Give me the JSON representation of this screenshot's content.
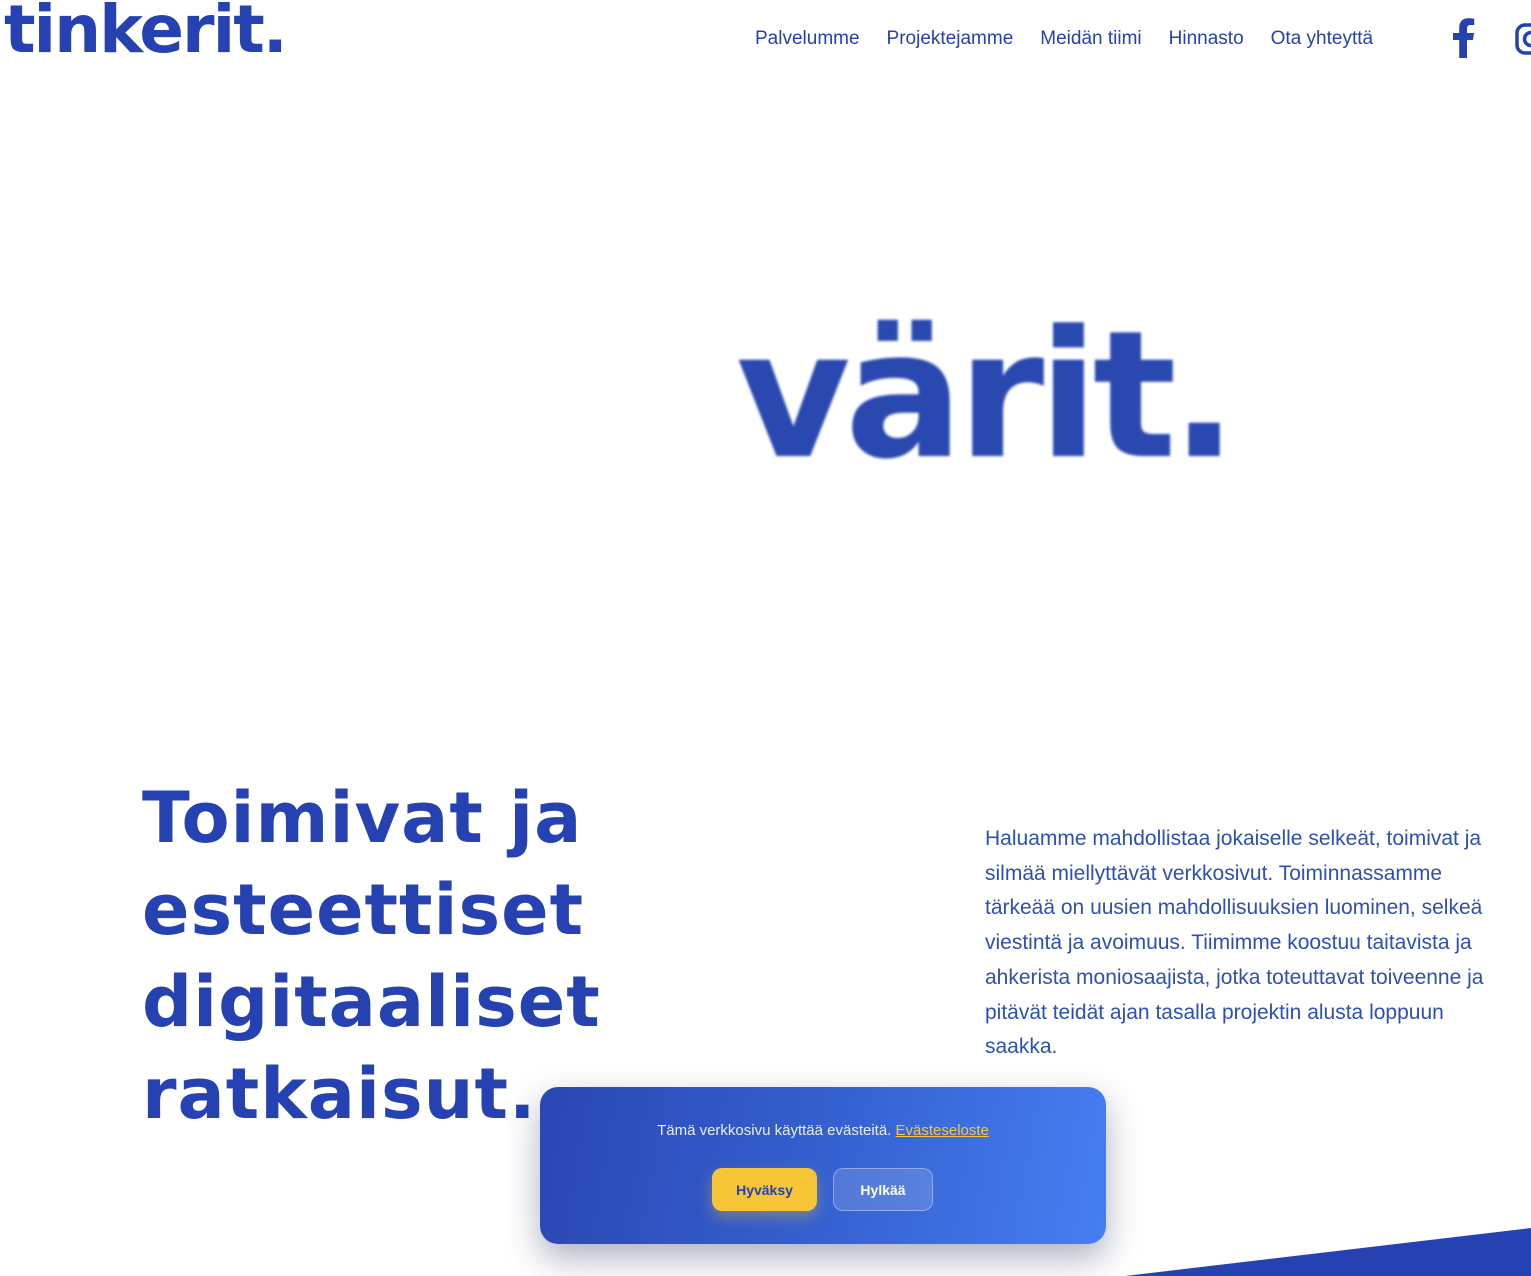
{
  "header": {
    "logo_text": "tinkerit.",
    "nav": [
      {
        "label": "Palvelumme"
      },
      {
        "label": "Projektejamme"
      },
      {
        "label": "Meidän tiimi"
      },
      {
        "label": "Hinnasto"
      },
      {
        "label": "Ota yhteyttä"
      }
    ],
    "social_icons": [
      "facebook-icon",
      "instagram-icon"
    ]
  },
  "hero": {
    "word": "värit."
  },
  "intro": {
    "headline": "Toimivat ja esteettiset digitaaliset ratkaisut.",
    "paragraph": "Haluamme mahdollistaa jokaiselle selkeät, toimivat ja silmää miellyttävät verkkosivut. Toiminnassamme tärkeää on uusien mahdollisuuksien luominen, selkeä viestintä ja avoimuus. Tiimimme koostuu taitavista ja ahkerista moniosaajista, jotka toteuttavat toiveenne ja pitävät teidät ajan tasalla projektin alusta loppuun saakka."
  },
  "cookie_banner": {
    "message": "Tämä verkkosivu käyttää evästeitä.",
    "link_label": "Evästeseloste",
    "accept_label": "Hyväksy",
    "reject_label": "Hylkää"
  },
  "colors": {
    "brand_blue": "#2541b2",
    "accent_yellow": "#f6c536",
    "banner_gradient_start": "#2a47b3",
    "banner_gradient_end": "#467ef2"
  }
}
